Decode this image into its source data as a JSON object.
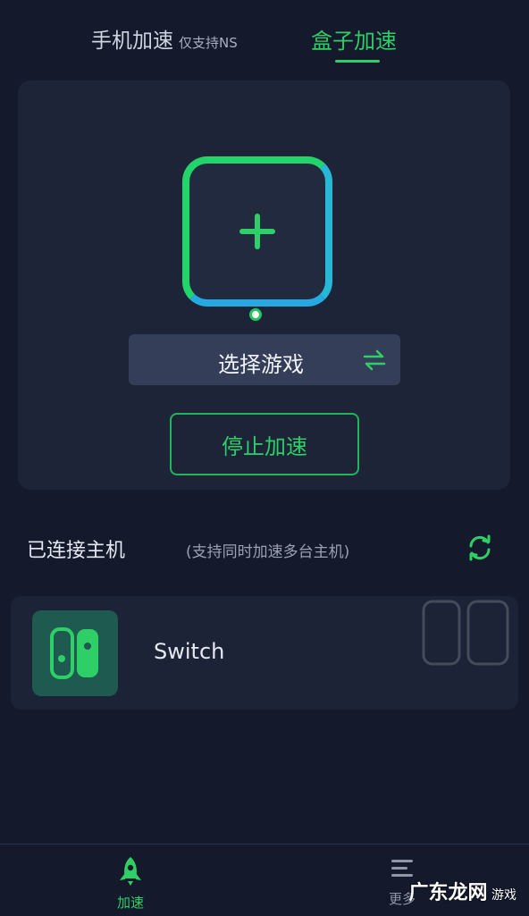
{
  "tabs": {
    "phone_label": "手机加速",
    "phone_sub": "仅支持NS",
    "box_label": "盒子加速"
  },
  "main": {
    "select_label": "选择游戏",
    "stop_label": "停止加速"
  },
  "hosts": {
    "title": "已连接主机",
    "note": "(支持同时加速多台主机)",
    "devices": [
      {
        "name": "Switch"
      }
    ]
  },
  "nav": {
    "accel_label": "加速",
    "more_label": "更多"
  },
  "watermark": {
    "brand": "广东龙网",
    "text": "游戏"
  },
  "colors": {
    "accent": "#2ecf66",
    "background": "#141a2c",
    "card": "#1d2438"
  }
}
